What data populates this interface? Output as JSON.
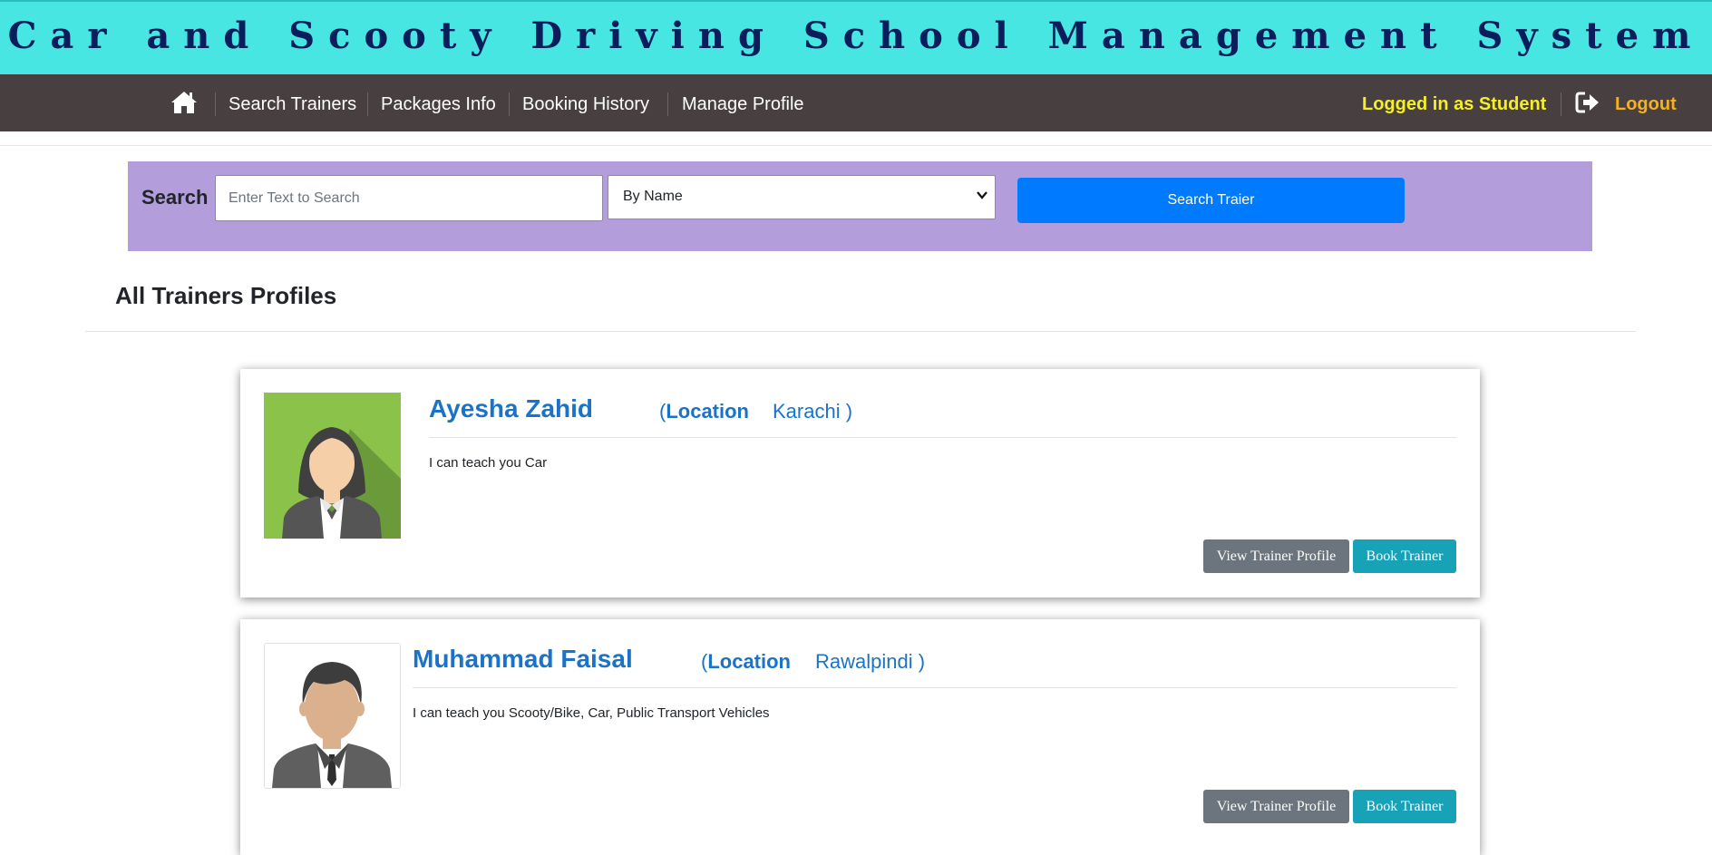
{
  "header": {
    "title": "Car and Scooty Driving School Management System",
    "bg_color": "#48e6e2"
  },
  "navbar": {
    "home_icon": "home-icon",
    "items": [
      {
        "label": "Search Trainers"
      },
      {
        "label": "Packages Info"
      },
      {
        "label": "Booking History"
      },
      {
        "label": "Manage Profile"
      }
    ],
    "status": "Logged in as Student",
    "logout_icon": "sign-out-icon",
    "logout_label": "Logout"
  },
  "search": {
    "label": "Search",
    "placeholder": "Enter Text to Search",
    "filter_selected": "By Name",
    "button_label": "Search Traier",
    "panel_color": "#b39ddb"
  },
  "main": {
    "heading": "All Trainers Profiles",
    "trainers": [
      {
        "name": "Ayesha Zahid",
        "location_open": "(",
        "location_label": "Location",
        "location_value": "Karachi )",
        "description": "I can teach you Car",
        "avatar": "female-avatar",
        "view_label": "View Trainer Profile",
        "book_label": "Book Trainer"
      },
      {
        "name": "Muhammad Faisal",
        "location_open": "(",
        "location_label": "Location",
        "location_value": "Rawalpindi )",
        "description": "I can teach you Scooty/Bike, Car, Public Transport Vehicles",
        "avatar": "male-avatar",
        "view_label": "View Trainer Profile",
        "book_label": "Book Trainer"
      }
    ]
  }
}
